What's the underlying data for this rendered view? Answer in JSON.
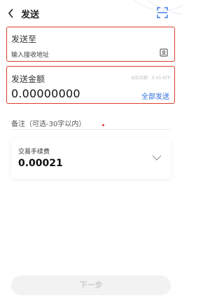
{
  "header": {
    "title": "发送"
  },
  "recipient": {
    "label": "发送至",
    "placeholder": "输入接收地址"
  },
  "amount": {
    "label": "发送金额",
    "balance_text": "当前余额：0.00 ATP",
    "value": "0.00000000",
    "send_all_label": "全部发送"
  },
  "remark": {
    "placeholder": "备注（可选-30字以内）"
  },
  "fee": {
    "label": "交易手续费",
    "value": "0.00021"
  },
  "footer": {
    "next_label": "下一步"
  },
  "colors": {
    "accent": "#2e6fe0",
    "highlight_border": "#d8402c",
    "disabled_button": "#f2f2f2"
  },
  "icons": [
    "back-icon",
    "scan-icon",
    "address-book-icon",
    "chevron-down-icon"
  ]
}
